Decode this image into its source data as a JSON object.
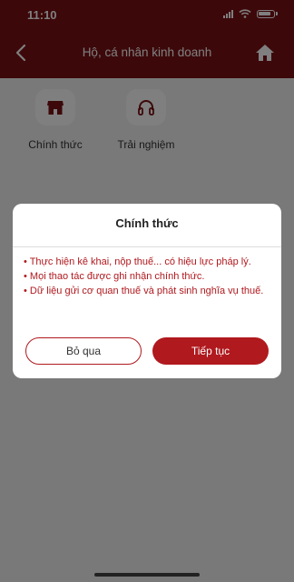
{
  "status_bar": {
    "time": "11:10"
  },
  "header": {
    "title": "Hộ, cá nhân kinh doanh"
  },
  "options": [
    {
      "label": "Chính thức",
      "icon": "store-icon"
    },
    {
      "label": "Trải nghiệm",
      "icon": "headphones-icon"
    }
  ],
  "dialog": {
    "title": "Chính thức",
    "lines": [
      "• Thực hiện kê khai, nộp thuế... có hiệu lực pháp lý.",
      "• Mọi thao tác được ghi nhận chính thức.",
      "• Dữ liệu gửi cơ quan thuế và phát sinh nghĩa vụ thuế."
    ],
    "cancel_label": "Bỏ qua",
    "confirm_label": "Tiếp tục"
  },
  "colors": {
    "header": "#7a1015",
    "accent": "#b0191e"
  }
}
